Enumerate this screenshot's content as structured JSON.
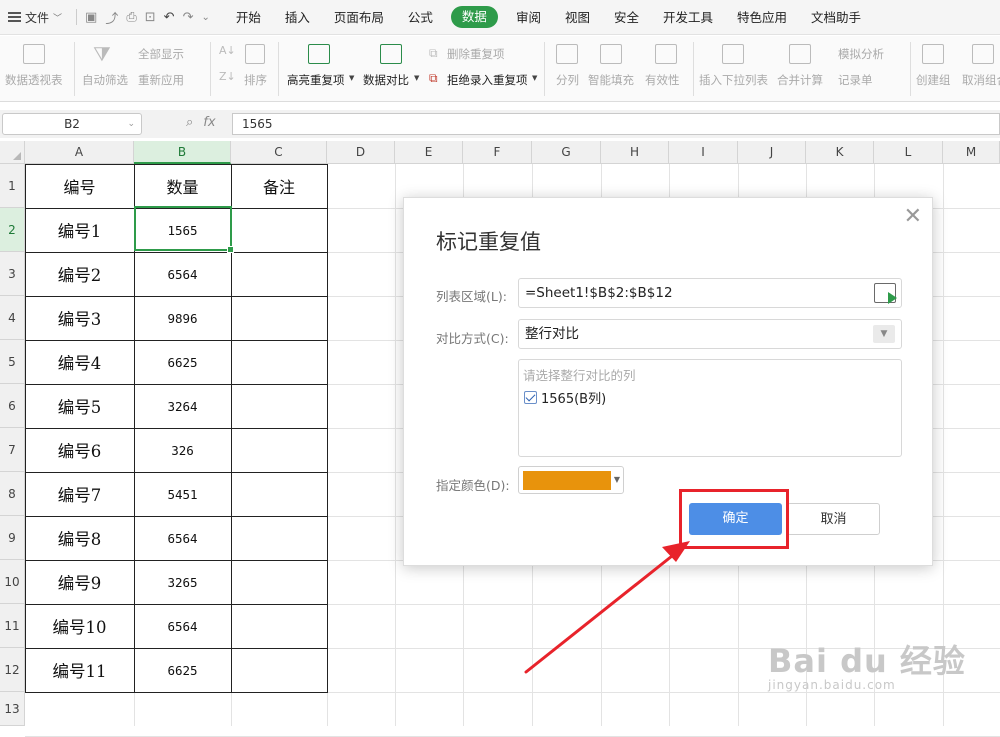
{
  "menubar": {
    "file_label": "文件",
    "tabs": [
      "开始",
      "插入",
      "页面布局",
      "公式",
      "数据",
      "审阅",
      "视图",
      "安全",
      "开发工具",
      "特色应用",
      "文档助手"
    ],
    "active_tab": "数据",
    "accent_color": "#2e9b4a"
  },
  "ribbon": {
    "pivot": "数据透视表",
    "autofilter": "自动筛选",
    "show_all": "全部显示",
    "reapply": "重新应用",
    "sort": "排序",
    "highlight_dup": "高亮重复项",
    "data_compare": "数据对比",
    "remove_dup": "删除重复项",
    "reject_dup": "拒绝录入重复项",
    "split": "分列",
    "smart_fill": "智能填充",
    "validity": "有效性",
    "insert_dropdown": "插入下拉列表",
    "merge_calc": "合并计算",
    "simulate": "模拟分析",
    "record_sheet": "记录单",
    "create_group": "创建组",
    "ungroup": "取消组合"
  },
  "formula_bar": {
    "name_box": "B2",
    "fx_label": "fx",
    "value": "1565"
  },
  "grid": {
    "columns": [
      "A",
      "B",
      "C",
      "D",
      "E",
      "F",
      "G",
      "H",
      "I",
      "J",
      "K",
      "L",
      "M"
    ],
    "rows": [
      "1",
      "2",
      "3",
      "4",
      "5",
      "6",
      "7",
      "8",
      "9",
      "10",
      "11",
      "12",
      "13"
    ],
    "headers": [
      "编号",
      "数量",
      "备注"
    ],
    "labels": [
      "编号1",
      "编号2",
      "编号3",
      "编号4",
      "编号5",
      "编号6",
      "编号7",
      "编号8",
      "编号9",
      "编号10",
      "编号11"
    ],
    "values": [
      "1565",
      "6564",
      "9896",
      "6625",
      "3264",
      "326",
      "5451",
      "6564",
      "3265",
      "6564",
      "6625"
    ]
  },
  "dialog": {
    "title": "标记重复值",
    "range_label": "列表区域(L):",
    "range_value": "=Sheet1!$B$2:$B$12",
    "compare_label": "对比方式(C):",
    "compare_value": "整行对比",
    "list_hint": "请选择整行对比的列",
    "list_item": "1565(B列)",
    "color_label": "指定颜色(D):",
    "color_value": "#e8930c",
    "ok_label": "确定",
    "cancel_label": "取消"
  },
  "annotation": {
    "highlight_color": "#e8232b"
  },
  "watermark": {
    "logo": "Bai du 经验",
    "url": "jingyan.baidu.com"
  }
}
